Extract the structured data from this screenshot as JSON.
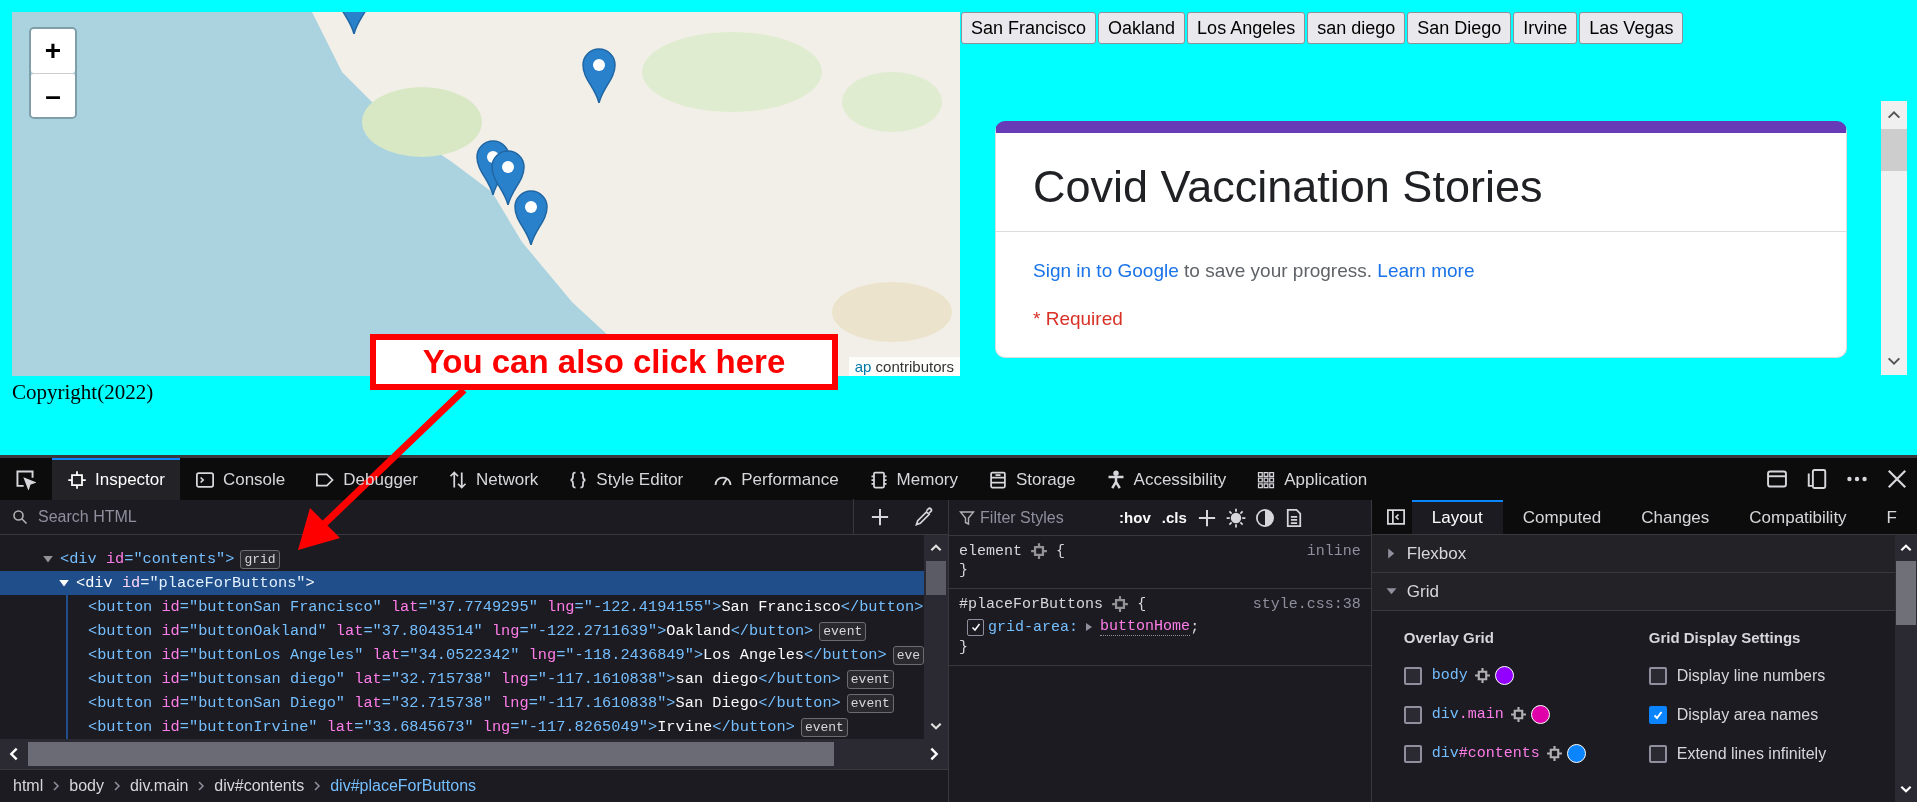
{
  "map": {
    "zoom_in": "+",
    "zoom_out": "–",
    "attribution_link": "ap",
    "attribution_text": "contributors"
  },
  "copyright": "Copyright(2022)",
  "city_buttons": [
    "San Francisco",
    "Oakland",
    "Los Angeles",
    "san diego",
    "San Diego",
    "Irvine",
    "Las Vegas"
  ],
  "form": {
    "title": "Covid Vaccination Stories",
    "signin_link": "Sign in to Google",
    "signin_text": "to save your progress.",
    "learn_more": "Learn more",
    "required": "* Required"
  },
  "callout": {
    "text": "You can also click here"
  },
  "devtools": {
    "tabs": [
      {
        "label": "Inspector",
        "selected": true
      },
      {
        "label": "Console",
        "selected": false
      },
      {
        "label": "Debugger",
        "selected": false
      },
      {
        "label": "Network",
        "selected": false
      },
      {
        "label": "Style Editor",
        "selected": false
      },
      {
        "label": "Performance",
        "selected": false
      },
      {
        "label": "Memory",
        "selected": false
      },
      {
        "label": "Storage",
        "selected": false
      },
      {
        "label": "Accessibility",
        "selected": false
      },
      {
        "label": "Application",
        "selected": false
      }
    ],
    "inspector": {
      "search_placeholder": "Search HTML",
      "rows": [
        {
          "expanded": true,
          "selected": false,
          "badge": "grid",
          "tokens": [
            {
              "kind": "tag",
              "text": "<div"
            },
            {
              "kind": "attr",
              "text": " id"
            },
            {
              "kind": "value",
              "text": "=\"contents\""
            },
            {
              "kind": "tag",
              "text": ">"
            }
          ],
          "children": [
            {
              "expanded": true,
              "selected": true,
              "tokens": [
                {
                  "kind": "tag",
                  "text": "<div"
                },
                {
                  "kind": "attr",
                  "text": " id"
                },
                {
                  "kind": "value",
                  "text": "=\"placeForButtons\""
                },
                {
                  "kind": "tag",
                  "text": ">"
                }
              ],
              "children": [
                {
                  "selected": false,
                  "tokens": [
                    {
                      "kind": "tag",
                      "text": "<button"
                    },
                    {
                      "kind": "attr",
                      "text": " id"
                    },
                    {
                      "kind": "value",
                      "text": "=\"buttonSan Francisco\""
                    },
                    {
                      "kind": "attr",
                      "text": " lat"
                    },
                    {
                      "kind": "value",
                      "text": "=\"37.7749295\""
                    },
                    {
                      "kind": "attr",
                      "text": " lng"
                    },
                    {
                      "kind": "value",
                      "text": "=\"-122.4194155\""
                    },
                    {
                      "kind": "tag",
                      "text": ">"
                    },
                    {
                      "kind": "text",
                      "text": "San Francisco"
                    },
                    {
                      "kind": "tag",
                      "text": "</button>"
                    }
                  ]
                },
                {
                  "selected": false,
                  "badge": "event",
                  "tokens": [
                    {
                      "kind": "tag",
                      "text": "<button"
                    },
                    {
                      "kind": "attr",
                      "text": " id"
                    },
                    {
                      "kind": "value",
                      "text": "=\"buttonOakland\""
                    },
                    {
                      "kind": "attr",
                      "text": " lat"
                    },
                    {
                      "kind": "value",
                      "text": "=\"37.8043514\""
                    },
                    {
                      "kind": "attr",
                      "text": " lng"
                    },
                    {
                      "kind": "value",
                      "text": "=\"-122.2711639\""
                    },
                    {
                      "kind": "tag",
                      "text": ">"
                    },
                    {
                      "kind": "text",
                      "text": "Oakland"
                    },
                    {
                      "kind": "tag",
                      "text": "</button>"
                    }
                  ]
                },
                {
                  "selected": false,
                  "badge": "eve",
                  "tokens": [
                    {
                      "kind": "tag",
                      "text": "<button"
                    },
                    {
                      "kind": "attr",
                      "text": " id"
                    },
                    {
                      "kind": "value",
                      "text": "=\"buttonLos Angeles\""
                    },
                    {
                      "kind": "attr",
                      "text": " lat"
                    },
                    {
                      "kind": "value",
                      "text": "=\"34.0522342\""
                    },
                    {
                      "kind": "attr",
                      "text": " lng"
                    },
                    {
                      "kind": "value",
                      "text": "=\"-118.2436849\""
                    },
                    {
                      "kind": "tag",
                      "text": ">"
                    },
                    {
                      "kind": "text",
                      "text": "Los Angeles"
                    },
                    {
                      "kind": "tag",
                      "text": "</button>"
                    }
                  ]
                },
                {
                  "selected": false,
                  "badge": "event",
                  "tokens": [
                    {
                      "kind": "tag",
                      "text": "<button"
                    },
                    {
                      "kind": "attr",
                      "text": " id"
                    },
                    {
                      "kind": "value",
                      "text": "=\"buttonsan diego\""
                    },
                    {
                      "kind": "attr",
                      "text": " lat"
                    },
                    {
                      "kind": "value",
                      "text": "=\"32.715738\""
                    },
                    {
                      "kind": "attr",
                      "text": " lng"
                    },
                    {
                      "kind": "value",
                      "text": "=\"-117.1610838\""
                    },
                    {
                      "kind": "tag",
                      "text": ">"
                    },
                    {
                      "kind": "text",
                      "text": "san diego"
                    },
                    {
                      "kind": "tag",
                      "text": "</button>"
                    }
                  ]
                },
                {
                  "selected": false,
                  "badge": "event",
                  "tokens": [
                    {
                      "kind": "tag",
                      "text": "<button"
                    },
                    {
                      "kind": "attr",
                      "text": " id"
                    },
                    {
                      "kind": "value",
                      "text": "=\"buttonSan Diego\""
                    },
                    {
                      "kind": "attr",
                      "text": " lat"
                    },
                    {
                      "kind": "value",
                      "text": "=\"32.715738\""
                    },
                    {
                      "kind": "attr",
                      "text": " lng"
                    },
                    {
                      "kind": "value",
                      "text": "=\"-117.1610838\""
                    },
                    {
                      "kind": "tag",
                      "text": ">"
                    },
                    {
                      "kind": "text",
                      "text": "San Diego"
                    },
                    {
                      "kind": "tag",
                      "text": "</button>"
                    }
                  ]
                },
                {
                  "selected": false,
                  "badge": "event",
                  "tokens": [
                    {
                      "kind": "tag",
                      "text": "<button"
                    },
                    {
                      "kind": "attr",
                      "text": " id"
                    },
                    {
                      "kind": "value",
                      "text": "=\"buttonIrvine\""
                    },
                    {
                      "kind": "attr",
                      "text": " lat"
                    },
                    {
                      "kind": "value",
                      "text": "=\"33.6845673\""
                    },
                    {
                      "kind": "attr",
                      "text": " lng"
                    },
                    {
                      "kind": "value",
                      "text": "=\"-117.8265049\""
                    },
                    {
                      "kind": "tag",
                      "text": ">"
                    },
                    {
                      "kind": "text",
                      "text": "Irvine"
                    },
                    {
                      "kind": "tag",
                      "text": "</button>"
                    }
                  ]
                }
              ]
            }
          ]
        }
      ],
      "breadcrumb": [
        {
          "label": "html",
          "selected": false
        },
        {
          "label": "body",
          "selected": false
        },
        {
          "label": "div.main",
          "selected": false
        },
        {
          "label": "div#contents",
          "selected": false
        },
        {
          "label": "div#placeForButtons",
          "selected": true
        }
      ]
    },
    "styles": {
      "filter_placeholder": "Filter Styles",
      "hov": ":hov",
      "cls": ".cls",
      "rules": [
        {
          "selector": "element",
          "open": "{",
          "source": "inline",
          "close": "}"
        },
        {
          "selector": "#placeForButtons",
          "open": "{",
          "source": "style.css:38",
          "close": "}",
          "declarations": [
            {
              "property": "grid-area:",
              "value": "buttonHome",
              "end": ";",
              "checked": true
            }
          ]
        }
      ]
    },
    "layout": {
      "tabs": [
        {
          "label": "Layout",
          "selected": true
        },
        {
          "label": "Computed",
          "selected": false
        },
        {
          "label": "Changes",
          "selected": false
        },
        {
          "label": "Compatibility",
          "selected": false
        },
        {
          "label": "F",
          "selected": false
        }
      ],
      "sections": [
        {
          "label": "Flexbox",
          "expanded": false
        },
        {
          "label": "Grid",
          "expanded": true
        }
      ],
      "overlay_title": "Overlay Grid",
      "overlay_items": [
        {
          "checked": false,
          "color": "#9400ff",
          "tokens": [
            {
              "kind": "tag",
              "text": "body"
            }
          ]
        },
        {
          "checked": false,
          "color": "#df00a9",
          "tokens": [
            {
              "kind": "tag",
              "text": "div"
            },
            {
              "kind": "attr",
              "text": ".main"
            }
          ]
        },
        {
          "checked": false,
          "color": "#0a84ff",
          "tokens": [
            {
              "kind": "tag",
              "text": "div"
            },
            {
              "kind": "attr",
              "text": "#contents"
            }
          ]
        }
      ],
      "settings_title": "Grid Display Settings",
      "settings": [
        {
          "label": "Display line numbers",
          "checked": false
        },
        {
          "label": "Display area names",
          "checked": true
        },
        {
          "label": "Extend lines infinitely",
          "checked": false
        }
      ]
    }
  }
}
